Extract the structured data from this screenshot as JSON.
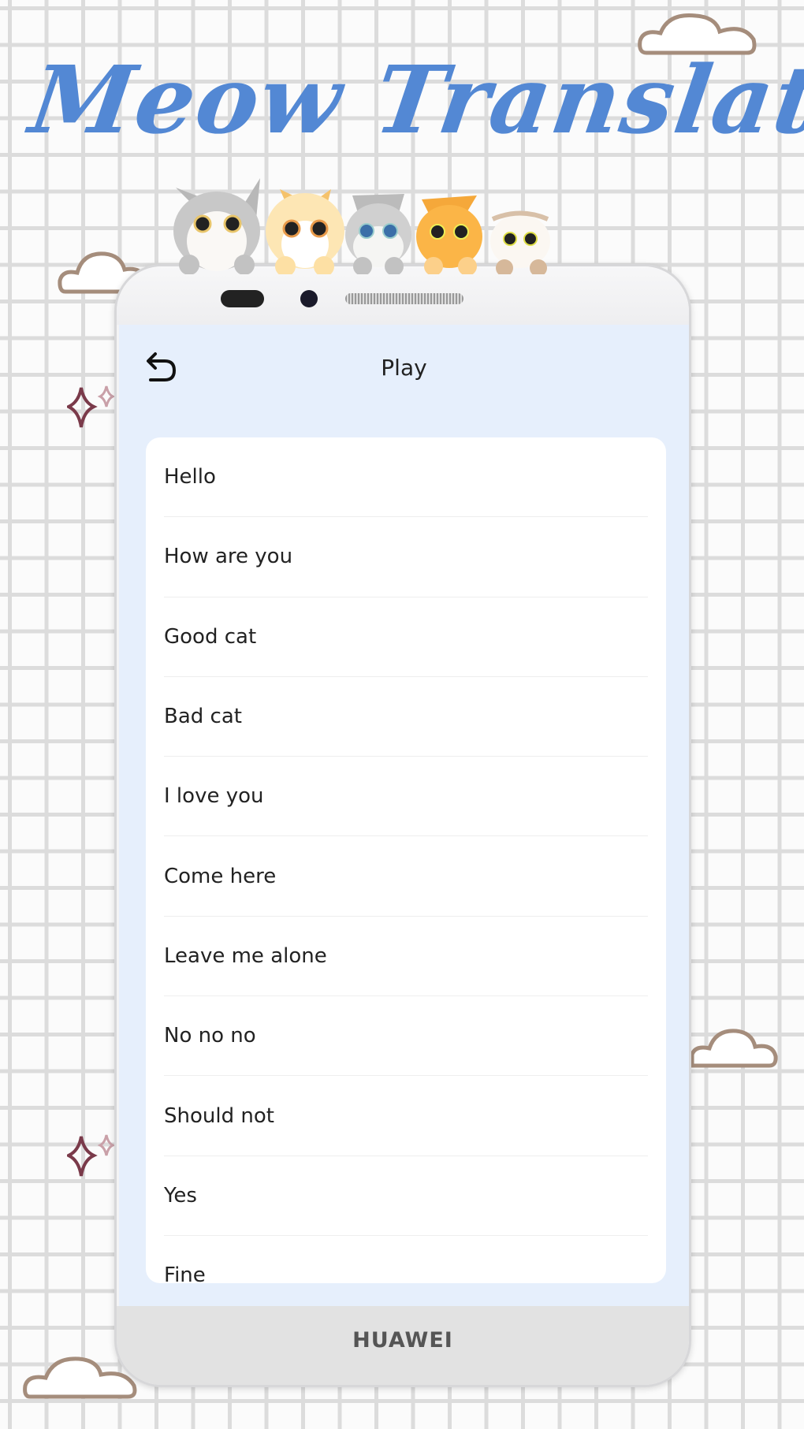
{
  "banner": {
    "title": "Meow Translator"
  },
  "device": {
    "brand": "HUAWEI"
  },
  "app": {
    "title": "Play",
    "back_icon": "undo-arrow-icon"
  },
  "phrases": [
    "Hello",
    "How are you",
    "Good cat",
    "Bad cat",
    "I love you",
    "Come here",
    "Leave me alone",
    "No no no",
    "Should not",
    "Yes",
    "Fine"
  ],
  "colors": {
    "title": "#5388d4",
    "screen_bg": "#e6effc"
  }
}
